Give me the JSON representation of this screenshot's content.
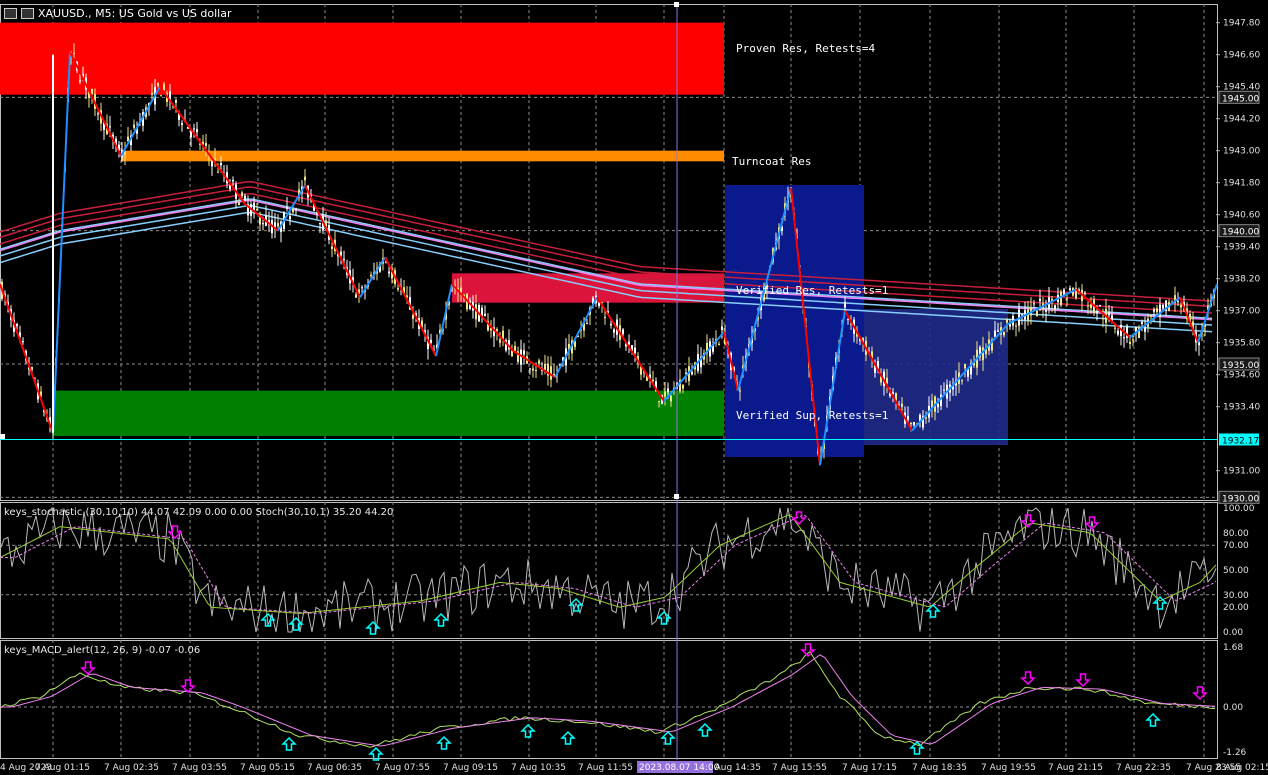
{
  "window": {
    "symbol_title": "XAUUSD., M5: US Gold vs US dollar"
  },
  "zones": [
    {
      "label": "Proven Res, Retests=4",
      "color": "#ff0000",
      "top": 1947.8,
      "bottom": 1945.1
    },
    {
      "label": "Turncoat Res",
      "color": "#ff8c00",
      "top": 1943.0,
      "bottom": 1942.6
    },
    {
      "label": "Verified Res, Retests=1",
      "color": "#dc143c",
      "top": 1938.4,
      "bottom": 1937.3
    },
    {
      "label": "Verified Sup, Retests=1",
      "color": "#008000",
      "top": 1934.0,
      "bottom": 1932.3
    }
  ],
  "main_price_axis": {
    "ticks": [
      "1947.80",
      "1946.60",
      "1945.40",
      "1944.20",
      "1943.00",
      "1941.80",
      "1940.60",
      "1939.40",
      "1938.20",
      "1937.00",
      "1935.80",
      "1934.60",
      "1933.40",
      "1931.00"
    ],
    "tick_values": [
      1947.8,
      1946.6,
      1945.4,
      1944.2,
      1943.0,
      1941.8,
      1940.6,
      1939.4,
      1938.2,
      1937.0,
      1935.8,
      1934.6,
      1933.4,
      1931.0
    ],
    "levels": [
      "1945.00",
      "1940.00",
      "1935.00",
      "1930.00"
    ],
    "level_values": [
      1945.0,
      1940.0,
      1935.0,
      1930.0
    ],
    "current_price": "1932.17",
    "current_value": 1932.17,
    "range": [
      1929.9,
      1948.5
    ]
  },
  "stochastic": {
    "title": "keys_stochastic (30,10,10) 44.07 42.09 0.00 0.00 Stoch(30,10,1) 35.20 44.20",
    "ticks": [
      "100.00",
      "80.00",
      "70.00",
      "50.00",
      "30.00",
      "20.00",
      "0.00"
    ],
    "tick_values": [
      100,
      80,
      70,
      50,
      30,
      20,
      0
    ]
  },
  "macd": {
    "title": "keys_MACD_alert(12, 26, 9) -0.07 -0.06",
    "ticks": [
      "1.68",
      "0.00",
      "-1.26"
    ],
    "tick_values": [
      1.68,
      0.0,
      -1.26
    ]
  },
  "time_axis": {
    "labels": [
      "4 Aug 2023",
      "7 Aug 01:15",
      "7 Aug 02:35",
      "7 Aug 03:55",
      "7 Aug 05:15",
      "7 Aug 06:35",
      "7 Aug 07:55",
      "7 Aug 09:15",
      "7 Aug 10:35",
      "7 Aug 11:55",
      "2023.08.07 14:00",
      "7 Aug 14:35",
      "7 Aug 15:55",
      "7 Aug 17:15",
      "7 Aug 18:35",
      "7 Aug 19:55",
      "7 Aug 21:15",
      "7 Aug 22:35",
      "7 Aug 23:55",
      "8 Aug 02:15"
    ],
    "crosshair_label": "2023.08.07 14:00"
  },
  "colors": {
    "background": "#000000",
    "grid": "#8c8c8c",
    "bull_candle": "#f0e68c",
    "bear_candle": "#ffffff",
    "zigzag_up": "#1e90ff",
    "zigzag_down": "#ff0000",
    "crosshair": "#9370db",
    "current_line": "#00ffff",
    "rect_blue": "#0a1a8c",
    "stoch_main": "#b8b8b8",
    "stoch_signal": "#9acd32",
    "macd_signal": "#ee82ee",
    "arrow_up": "#00ffff",
    "arrow_down": "#ff00ff"
  }
}
